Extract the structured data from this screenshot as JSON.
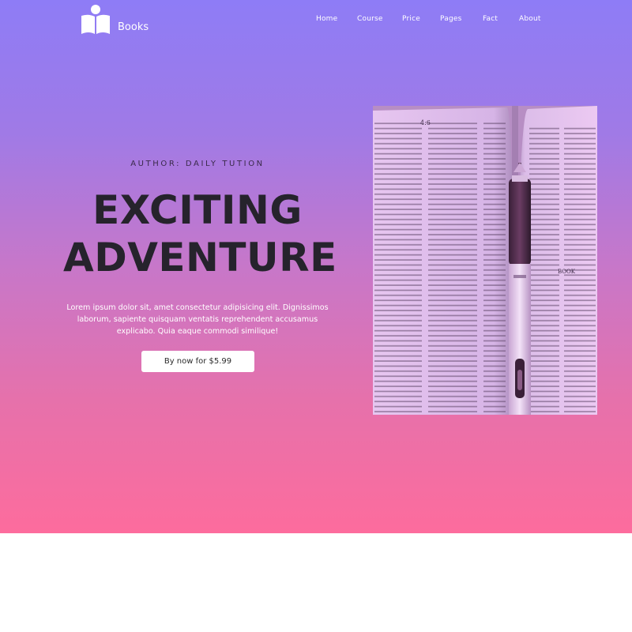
{
  "brand": {
    "name": "Books",
    "logo_icon": "reader-book-icon"
  },
  "nav": {
    "items": [
      {
        "label": "Home"
      },
      {
        "label": "Course"
      },
      {
        "label": "Price"
      },
      {
        "label": "Pages"
      },
      {
        "label": "Fact"
      },
      {
        "label": "About"
      }
    ]
  },
  "hero": {
    "author": "AUTHOR: DAILY TUTION",
    "headline_line1": "EXCITING",
    "headline_line2": "ADVENTURE",
    "description": "Lorem ipsum dolor sit, amet consectetur adipisicing elit. Dignissimos laborum, sapiente quisquam ventatis reprehendent accusamus explicabo. Quia eaque commodi similique!",
    "cta_label": "By now for $5.99",
    "image": {
      "description_icon": "open-book-with-pen-photo",
      "page_number": "4:6",
      "side_label": "BOOK"
    }
  },
  "colors": {
    "gradient_top": "#8e7cf6",
    "gradient_bottom": "#fd6c9d",
    "headline": "#26232c",
    "button_bg": "#ffffff"
  }
}
